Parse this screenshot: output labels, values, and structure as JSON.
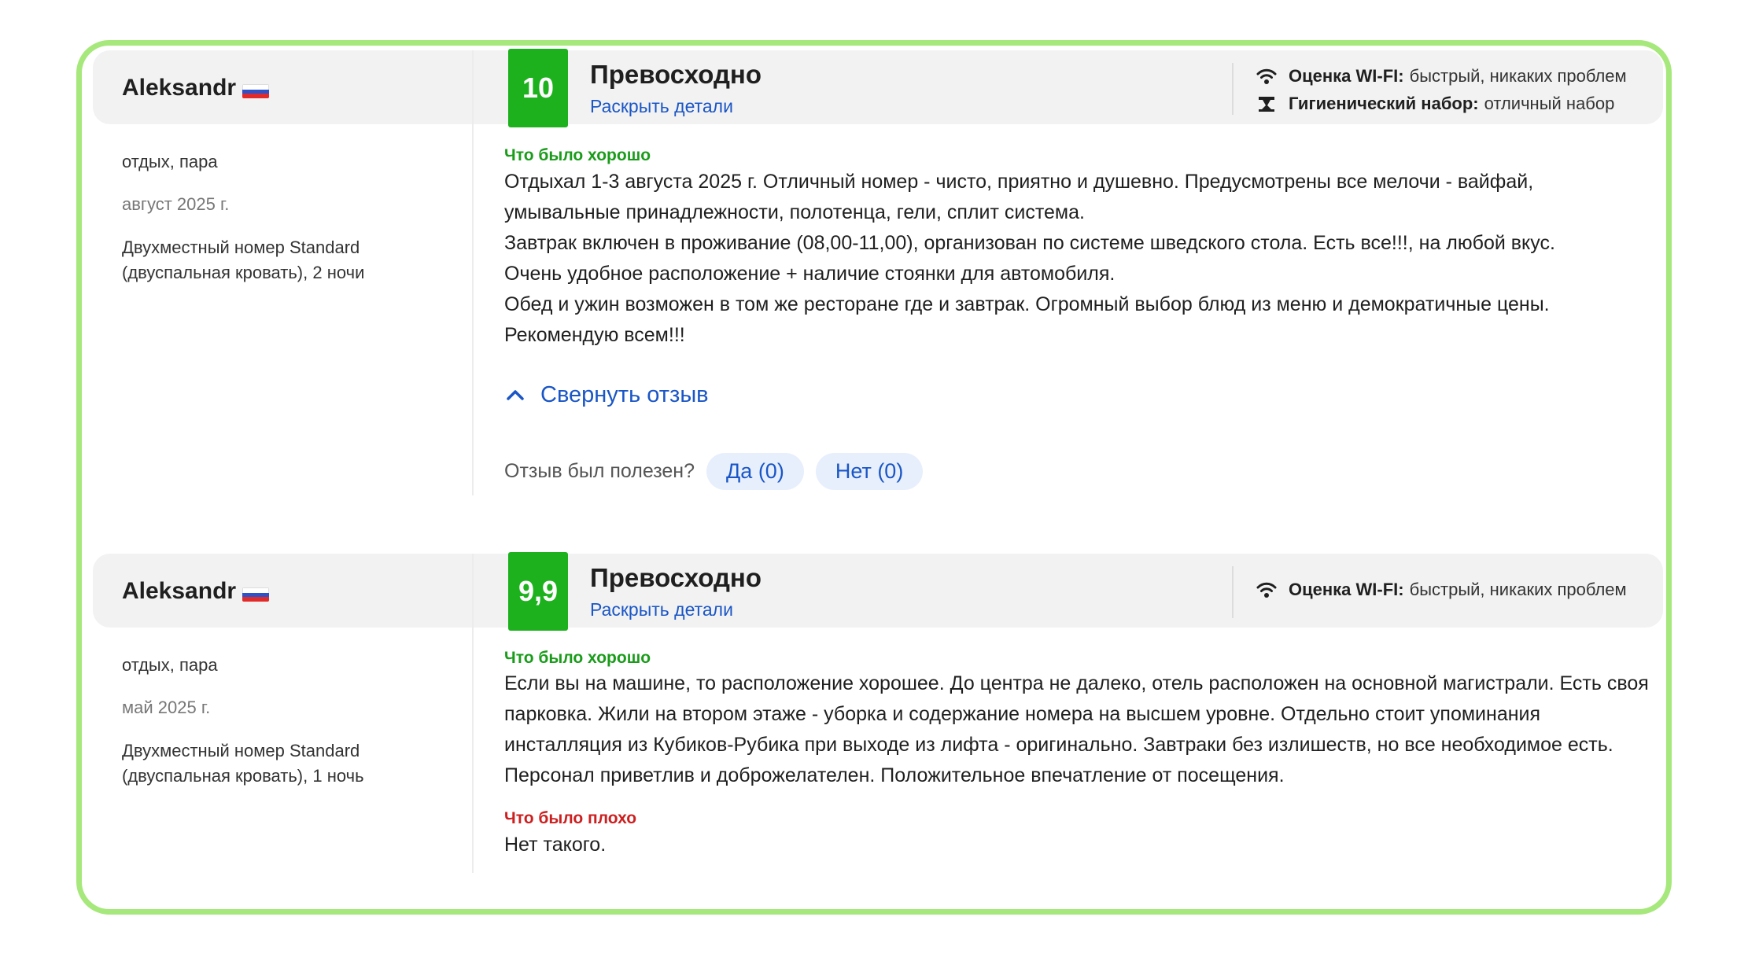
{
  "reviews": [
    {
      "reviewer": "Aleksandr",
      "trip_type": "отдых, пара",
      "date": "август 2025 г.",
      "room": "Двухместный номер Standard (двуспальная кровать), 2 ночи",
      "score": "10",
      "score_title": "Превосходно",
      "details_link": "Раскрыть детали",
      "features": [
        {
          "icon": "wifi-icon",
          "label": "Оценка WI-FI:",
          "value": "быстрый, никаких проблем"
        },
        {
          "icon": "hygiene-kit-icon",
          "label": "Гигиенический набор:",
          "value": "отличный набор"
        }
      ],
      "good_label": "Что было хорошо",
      "good_text": [
        "Отдыхал 1-3 августа 2025 г. Отличный номер - чисто, приятно и душевно. Предусмотрены все мелочи - вайфай, умывальные принадлежности, полотенца, гели, сплит система.",
        "Завтрак включен в проживание (08,00-11,00), организован по системе шведского стола. Есть все!!!, на любой вкус.",
        "Очень удобное расположение + наличие стоянки для автомобиля.",
        "Обед и ужин возможен в том же ресторане где и завтрак. Огромный выбор блюд из меню и демократичные цены.",
        "Рекомендую всем!!!"
      ],
      "collapse_label": "Свернуть отзыв",
      "helpful_question": "Отзыв был полезен?",
      "yes_label": "Да (0)",
      "no_label": "Нет (0)"
    },
    {
      "reviewer": "Aleksandr",
      "trip_type": "отдых, пара",
      "date": "май 2025 г.",
      "room": "Двухместный номер Standard (двуспальная кровать), 1 ночь",
      "score": "9,9",
      "score_title": "Превосходно",
      "details_link": "Раскрыть детали",
      "features": [
        {
          "icon": "wifi-icon",
          "label": "Оценка WI-FI:",
          "value": "быстрый, никаких проблем"
        }
      ],
      "good_label": "Что было хорошо",
      "good_text": [
        "Если вы на машине, то расположение хорошее. До центра не далеко, отель расположен на основной магистрали. Есть своя парковка. Жили на втором этаже - уборка и содержание номера на высшем уровне. Отдельно стоит упоминания инсталляция из Кубиков-Рубика при выходе из лифта - оригинально. Завтраки без излишеств, но все необходимое есть. Персонал приветлив и доброжелателен. Положительное впечатление от посещения."
      ],
      "bad_label": "Что было плохо",
      "bad_text": "Нет такого."
    }
  ],
  "colors": {
    "frame_border": "#a6e87b",
    "score_green": "#1db21d",
    "link_blue": "#1a56c6",
    "good_green": "#1a9c1a",
    "bad_red": "#cc1f1f",
    "header_bg": "#f2f2f2"
  },
  "flag": "russia-flag"
}
